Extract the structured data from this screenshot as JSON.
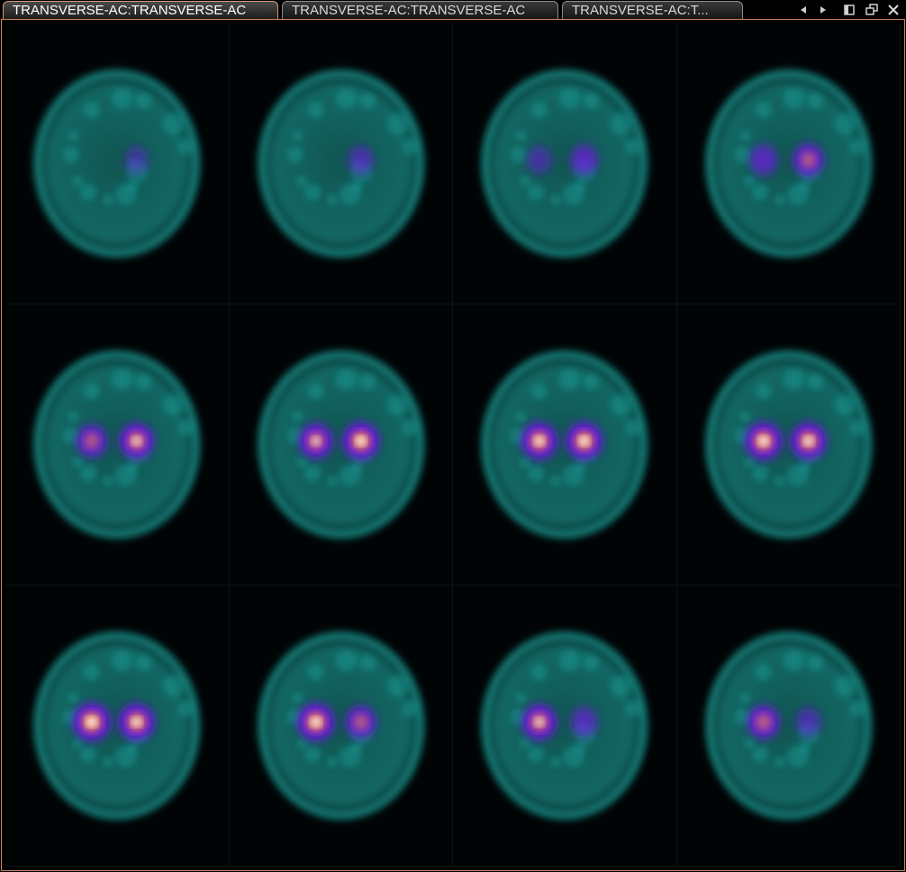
{
  "tabs": [
    {
      "label": "TRANSVERSE-AC:TRANSVERSE-AC",
      "active": true
    },
    {
      "label": "TRANSVERSE-AC:TRANSVERSE-AC",
      "active": false
    },
    {
      "label": "TRANSVERSE-AC:T...",
      "active": false
    }
  ],
  "controls": [
    "prev-arrow-icon",
    "next-arrow-icon",
    "panel-layout-icon",
    "restore-window-icon",
    "close-icon"
  ],
  "colors": {
    "active_tab_border": "#d8956a",
    "viewer_border": "#c9855e",
    "background_uptake": "#1fb8b0",
    "low_uptake": "#6a18d8",
    "mid_uptake": "#f08a4a",
    "peak_uptake": "#ffffff"
  },
  "slices": [
    {
      "intensity_left": 0.0,
      "intensity_right": 0.1
    },
    {
      "intensity_left": 0.0,
      "intensity_right": 0.2
    },
    {
      "intensity_left": 0.15,
      "intensity_right": 0.35
    },
    {
      "intensity_left": 0.35,
      "intensity_right": 0.5
    },
    {
      "intensity_left": 0.5,
      "intensity_right": 0.7
    },
    {
      "intensity_left": 0.65,
      "intensity_right": 0.85
    },
    {
      "intensity_left": 0.8,
      "intensity_right": 0.85
    },
    {
      "intensity_left": 0.85,
      "intensity_right": 0.8
    },
    {
      "intensity_left": 0.9,
      "intensity_right": 0.8
    },
    {
      "intensity_left": 0.85,
      "intensity_right": 0.5
    },
    {
      "intensity_left": 0.7,
      "intensity_right": 0.3
    },
    {
      "intensity_left": 0.55,
      "intensity_right": 0.2
    }
  ]
}
